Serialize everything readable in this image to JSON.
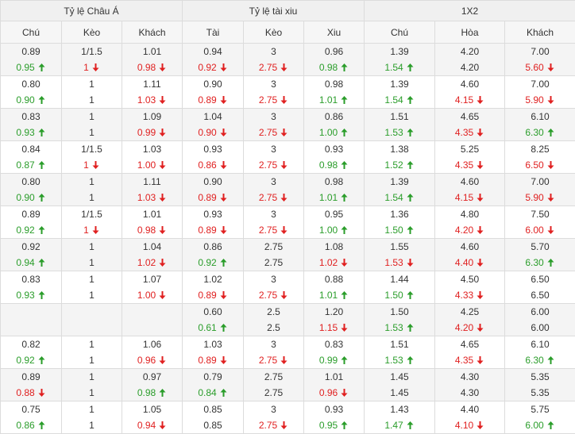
{
  "header": {
    "groups": [
      "Tỷ lệ Châu Á",
      "Tỷ lệ tài xiu",
      "1X2"
    ],
    "columns": [
      "Chú",
      "Kèo",
      "Khách",
      "Tài",
      "Kèo",
      "Xiu",
      "Chú",
      "Hòa",
      "Khách"
    ]
  },
  "rows": [
    [
      [
        "0.89",
        ""
      ],
      [
        "1/1.5",
        ""
      ],
      [
        "1.01",
        ""
      ],
      [
        "0.94",
        ""
      ],
      [
        "3",
        ""
      ],
      [
        "0.96",
        ""
      ],
      [
        "1.39",
        ""
      ],
      [
        "4.20",
        ""
      ],
      [
        "7.00",
        ""
      ],
      [
        "0.95",
        "up"
      ],
      [
        "1",
        "down"
      ],
      [
        "0.98",
        "down"
      ],
      [
        "0.92",
        "down"
      ],
      [
        "2.75",
        "down"
      ],
      [
        "0.98",
        "up"
      ],
      [
        "1.54",
        "up"
      ],
      [
        "4.20",
        ""
      ],
      [
        "5.60",
        "down"
      ]
    ],
    [
      [
        "0.80",
        ""
      ],
      [
        "1",
        ""
      ],
      [
        "1.11",
        ""
      ],
      [
        "0.90",
        ""
      ],
      [
        "3",
        ""
      ],
      [
        "0.98",
        ""
      ],
      [
        "1.39",
        ""
      ],
      [
        "4.60",
        ""
      ],
      [
        "7.00",
        ""
      ],
      [
        "0.90",
        "up"
      ],
      [
        "1",
        ""
      ],
      [
        "1.03",
        "down"
      ],
      [
        "0.89",
        "down"
      ],
      [
        "2.75",
        "down"
      ],
      [
        "1.01",
        "up"
      ],
      [
        "1.54",
        "up"
      ],
      [
        "4.15",
        "down"
      ],
      [
        "5.90",
        "down"
      ]
    ],
    [
      [
        "0.83",
        ""
      ],
      [
        "1",
        ""
      ],
      [
        "1.09",
        ""
      ],
      [
        "1.04",
        ""
      ],
      [
        "3",
        ""
      ],
      [
        "0.86",
        ""
      ],
      [
        "1.51",
        ""
      ],
      [
        "4.65",
        ""
      ],
      [
        "6.10",
        ""
      ],
      [
        "0.93",
        "up"
      ],
      [
        "1",
        ""
      ],
      [
        "0.99",
        "down"
      ],
      [
        "0.90",
        "down"
      ],
      [
        "2.75",
        "down"
      ],
      [
        "1.00",
        "up"
      ],
      [
        "1.53",
        "up"
      ],
      [
        "4.35",
        "down"
      ],
      [
        "6.30",
        "up"
      ]
    ],
    [
      [
        "0.84",
        ""
      ],
      [
        "1/1.5",
        ""
      ],
      [
        "1.03",
        ""
      ],
      [
        "0.93",
        ""
      ],
      [
        "3",
        ""
      ],
      [
        "0.93",
        ""
      ],
      [
        "1.38",
        ""
      ],
      [
        "5.25",
        ""
      ],
      [
        "8.25",
        ""
      ],
      [
        "0.87",
        "up"
      ],
      [
        "1",
        "down"
      ],
      [
        "1.00",
        "down"
      ],
      [
        "0.86",
        "down"
      ],
      [
        "2.75",
        "down"
      ],
      [
        "0.98",
        "up"
      ],
      [
        "1.52",
        "up"
      ],
      [
        "4.35",
        "down"
      ],
      [
        "6.50",
        "down"
      ]
    ],
    [
      [
        "0.80",
        ""
      ],
      [
        "1",
        ""
      ],
      [
        "1.11",
        ""
      ],
      [
        "0.90",
        ""
      ],
      [
        "3",
        ""
      ],
      [
        "0.98",
        ""
      ],
      [
        "1.39",
        ""
      ],
      [
        "4.60",
        ""
      ],
      [
        "7.00",
        ""
      ],
      [
        "0.90",
        "up"
      ],
      [
        "1",
        ""
      ],
      [
        "1.03",
        "down"
      ],
      [
        "0.89",
        "down"
      ],
      [
        "2.75",
        "down"
      ],
      [
        "1.01",
        "up"
      ],
      [
        "1.54",
        "up"
      ],
      [
        "4.15",
        "down"
      ],
      [
        "5.90",
        "down"
      ]
    ],
    [
      [
        "0.89",
        ""
      ],
      [
        "1/1.5",
        ""
      ],
      [
        "1.01",
        ""
      ],
      [
        "0.93",
        ""
      ],
      [
        "3",
        ""
      ],
      [
        "0.95",
        ""
      ],
      [
        "1.36",
        ""
      ],
      [
        "4.80",
        ""
      ],
      [
        "7.50",
        ""
      ],
      [
        "0.92",
        "up"
      ],
      [
        "1",
        "down"
      ],
      [
        "0.98",
        "down"
      ],
      [
        "0.89",
        "down"
      ],
      [
        "2.75",
        "down"
      ],
      [
        "1.00",
        "up"
      ],
      [
        "1.50",
        "up"
      ],
      [
        "4.20",
        "down"
      ],
      [
        "6.00",
        "down"
      ]
    ],
    [
      [
        "0.92",
        ""
      ],
      [
        "1",
        ""
      ],
      [
        "1.04",
        ""
      ],
      [
        "0.86",
        ""
      ],
      [
        "2.75",
        ""
      ],
      [
        "1.08",
        ""
      ],
      [
        "1.55",
        ""
      ],
      [
        "4.60",
        ""
      ],
      [
        "5.70",
        ""
      ],
      [
        "0.94",
        "up"
      ],
      [
        "1",
        ""
      ],
      [
        "1.02",
        "down"
      ],
      [
        "0.92",
        "up"
      ],
      [
        "2.75",
        ""
      ],
      [
        "1.02",
        "down"
      ],
      [
        "1.53",
        "down"
      ],
      [
        "4.40",
        "down"
      ],
      [
        "6.30",
        "up"
      ]
    ],
    [
      [
        "0.83",
        ""
      ],
      [
        "1",
        ""
      ],
      [
        "1.07",
        ""
      ],
      [
        "1.02",
        ""
      ],
      [
        "3",
        ""
      ],
      [
        "0.88",
        ""
      ],
      [
        "1.44",
        ""
      ],
      [
        "4.50",
        ""
      ],
      [
        "6.50",
        ""
      ],
      [
        "0.93",
        "up"
      ],
      [
        "1",
        ""
      ],
      [
        "1.00",
        "down"
      ],
      [
        "0.89",
        "down"
      ],
      [
        "2.75",
        "down"
      ],
      [
        "1.01",
        "up"
      ],
      [
        "1.50",
        "up"
      ],
      [
        "4.33",
        "down"
      ],
      [
        "6.50",
        ""
      ]
    ],
    [
      [
        "",
        ""
      ],
      [
        "",
        ""
      ],
      [
        "",
        ""
      ],
      [
        "0.60",
        ""
      ],
      [
        "2.5",
        ""
      ],
      [
        "1.20",
        ""
      ],
      [
        "1.50",
        ""
      ],
      [
        "4.25",
        ""
      ],
      [
        "6.00",
        ""
      ],
      [
        "",
        ""
      ],
      [
        "",
        ""
      ],
      [
        "",
        ""
      ],
      [
        "0.61",
        "up"
      ],
      [
        "2.5",
        ""
      ],
      [
        "1.15",
        "down"
      ],
      [
        "1.53",
        "up"
      ],
      [
        "4.20",
        "down"
      ],
      [
        "6.00",
        ""
      ]
    ],
    [
      [
        "0.82",
        ""
      ],
      [
        "1",
        ""
      ],
      [
        "1.06",
        ""
      ],
      [
        "1.03",
        ""
      ],
      [
        "3",
        ""
      ],
      [
        "0.83",
        ""
      ],
      [
        "1.51",
        ""
      ],
      [
        "4.65",
        ""
      ],
      [
        "6.10",
        ""
      ],
      [
        "0.92",
        "up"
      ],
      [
        "1",
        ""
      ],
      [
        "0.96",
        "down"
      ],
      [
        "0.89",
        "down"
      ],
      [
        "2.75",
        "down"
      ],
      [
        "0.99",
        "up"
      ],
      [
        "1.53",
        "up"
      ],
      [
        "4.35",
        "down"
      ],
      [
        "6.30",
        "up"
      ]
    ],
    [
      [
        "0.89",
        ""
      ],
      [
        "1",
        ""
      ],
      [
        "0.97",
        ""
      ],
      [
        "0.79",
        ""
      ],
      [
        "2.75",
        ""
      ],
      [
        "1.01",
        ""
      ],
      [
        "1.45",
        ""
      ],
      [
        "4.30",
        ""
      ],
      [
        "5.35",
        ""
      ],
      [
        "0.88",
        "down"
      ],
      [
        "1",
        ""
      ],
      [
        "0.98",
        "up"
      ],
      [
        "0.84",
        "up"
      ],
      [
        "2.75",
        ""
      ],
      [
        "0.96",
        "down"
      ],
      [
        "1.45",
        ""
      ],
      [
        "4.30",
        ""
      ],
      [
        "5.35",
        ""
      ]
    ],
    [
      [
        "0.75",
        ""
      ],
      [
        "1",
        ""
      ],
      [
        "1.05",
        ""
      ],
      [
        "0.85",
        ""
      ],
      [
        "3",
        ""
      ],
      [
        "0.93",
        ""
      ],
      [
        "1.43",
        ""
      ],
      [
        "4.40",
        ""
      ],
      [
        "5.75",
        ""
      ],
      [
        "0.86",
        "up"
      ],
      [
        "1",
        ""
      ],
      [
        "0.94",
        "down"
      ],
      [
        "0.85",
        ""
      ],
      [
        "2.75",
        "down"
      ],
      [
        "0.95",
        "up"
      ],
      [
        "1.47",
        "up"
      ],
      [
        "4.10",
        "down"
      ],
      [
        "6.00",
        "up"
      ]
    ]
  ]
}
